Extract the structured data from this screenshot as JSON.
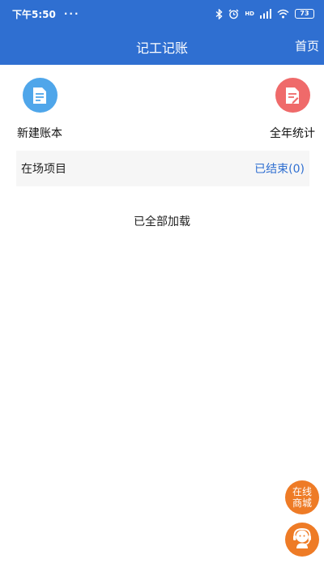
{
  "status_bar": {
    "time": "下午5:50",
    "dots": "···",
    "network_tag": "HD",
    "battery": "73",
    "icons": [
      "bluetooth-icon",
      "alarm-icon",
      "signal-icon",
      "wifi-icon",
      "battery-icon"
    ]
  },
  "header": {
    "title": "记工记账",
    "home_link": "首页",
    "color": "#2f6fd1"
  },
  "quick_actions": {
    "new_book": {
      "label": "新建账本",
      "icon": "ledger-icon",
      "color": "#4fa6ea"
    },
    "yearly_stats": {
      "label": "全年统计",
      "icon": "ledger-edit-icon",
      "color": "#ef6a6a"
    }
  },
  "project_bar": {
    "onsite_label": "在场项目",
    "ended_label": "已结束(0)"
  },
  "list": {
    "end_message": "已全部加载"
  },
  "floating": {
    "mall_line1": "在线",
    "mall_line2": "商城",
    "service_icon": "customer-service-icon",
    "color": "#ee7b26"
  }
}
